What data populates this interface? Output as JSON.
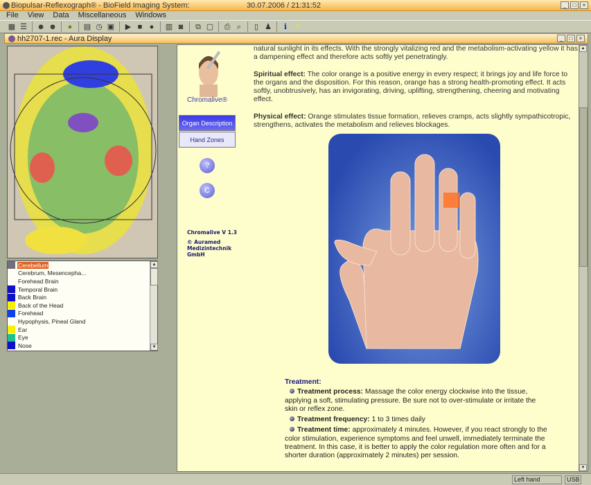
{
  "app": {
    "title": "Biopulsar-Reflexograph® - BioField Imaging System:",
    "datetime": "30.07.2006 / 21:31:52"
  },
  "menu": [
    "File",
    "View",
    "Data",
    "Miscellaneous",
    "Windows"
  ],
  "window": {
    "title": "hh2707-1.rec  - Aura Display"
  },
  "organs": [
    {
      "label": "Cerebellum",
      "color": "#707080",
      "selected": true
    },
    {
      "label": "Cerebrum, Mesencepha...",
      "color": null
    },
    {
      "label": "Forehead Brain",
      "color": null
    },
    {
      "label": "Temporal Brain",
      "color": "#1010c8"
    },
    {
      "label": "Back Brain",
      "color": "#1010c8"
    },
    {
      "label": "Back of the Head",
      "color": "#f8f000"
    },
    {
      "label": "Forehead",
      "color": "#1040e8"
    },
    {
      "label": "Hypophysis, Pineal Gland",
      "color": null
    },
    {
      "label": "Ear",
      "color": "#f8f000"
    },
    {
      "label": "Eye",
      "color": "#20c090"
    },
    {
      "label": "Nose",
      "color": "#1010c8"
    }
  ],
  "nav": {
    "brand": "Chromalive®",
    "organ_description": "Organ Description",
    "hand_zones": "Hand Zones",
    "help": "?",
    "copyright_btn": "C",
    "version": "Chromalive V 1.3",
    "company": "© Auramed Medizintechnik GmbH"
  },
  "text": {
    "intro": "natural sunlight in its effects. With the strongly vitalizing red and the metabolism-activating yellow it has a dampening effect and therefore acts softly yet penetratingly.",
    "spiritual_label": "Spiritual effect:",
    "spiritual": " The color orange is a positive energy in every respect; it brings joy and life force to the organs and the disposition. For this reason, orange has a strong health-promoting effect. It acts softly, unobtrusively, has an invigorating, driving, uplifting, strengthening, cheering and motivating effect.",
    "physical_label": "Physical effect:",
    "physical": " Orange stimulates tissue formation, relieves cramps, acts slightly sympathicotropic, strengthens, activates the metabolism and relieves blockages."
  },
  "treatment": {
    "heading": "Treatment:",
    "items": [
      {
        "label": "Treatment process:",
        "text": " Massage the color energy clockwise into the tissue, applying a soft, stimulating pressure. Be sure not to over-stimulate or irritate the skin or reflex zone."
      },
      {
        "label": "Treatment frequency:",
        "text": " 1 to 3 times daily"
      },
      {
        "label": "Treatment time:",
        "text": " approximately 4 minutes. However, if you react strongly to the color stimulation, experience symptoms and feel unwell, immediately terminate the treatment. In this case, it is better to apply the color regulation more often and for a shorter duration (approximately 2 minutes) per session."
      }
    ]
  },
  "status": {
    "hand": "Left hand",
    "connection": "USB"
  }
}
